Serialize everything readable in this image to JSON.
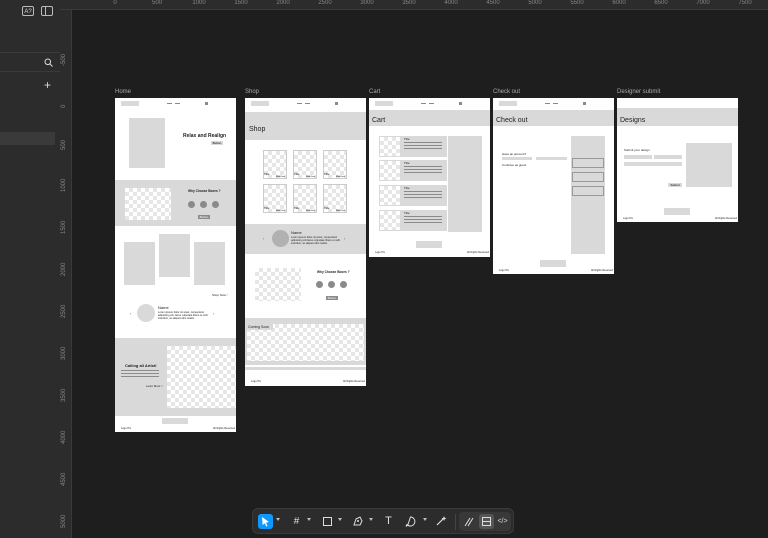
{
  "canvas": {
    "ruler_top": [
      "0",
      "500",
      "1000",
      "1500",
      "2000",
      "2500",
      "3000",
      "3500",
      "4000",
      "4500",
      "5000",
      "5500",
      "6000",
      "6500",
      "7000",
      "7500"
    ],
    "ruler_left": [
      "-500",
      "0",
      "500",
      "1000",
      "1500",
      "2000",
      "2500",
      "3000",
      "3500",
      "4000",
      "4500",
      "5000"
    ]
  },
  "sidebar": {
    "ai_icon": "A?"
  },
  "frames": {
    "home": {
      "label": "Home",
      "hero_title": "Relax and Realign",
      "hero_button": "Button",
      "why_title": "Why Choose Boxes ?",
      "why_button": "Button",
      "shop_now": "Shop Now !",
      "testimonial_name": "Name",
      "testimonial_text": "Lorem ipsum dolor sit amet, consectetur adipiscing elit, lacus vulputate libero et velit interdum, ac aliquet odio mattis.",
      "artist_title": "Calling all Artist!",
      "artist_link": "Learn More >",
      "footer_logo": "Logo Hm",
      "footer_copy": "All Rights Reserved"
    },
    "shop": {
      "label": "Shop",
      "page_title": "Shop",
      "product_title": "Title",
      "product_price": "$Add Item",
      "testimonial_name": "Name",
      "testimonial_text": "Lorem ipsum dolor sit amet, consectetur adipiscing elit lacus vulputate libero et velit interdum, ac aliquet odio mattis.",
      "why_title": "Why Choose Boxes ?",
      "why_button": "Button",
      "coming_soon": "Coming Soon",
      "footer_logo": "Logo Hm",
      "footer_copy": "All Rights Reserved"
    },
    "cart": {
      "label": "Cart",
      "page_title": "Cart",
      "item_title": "Title",
      "footer_logo": "Logo Hm",
      "footer_copy": "All Rights Reserved"
    },
    "checkout": {
      "label": "Check out",
      "page_title": "Check out",
      "account_q": "Have an account?",
      "guest": "Continue as guest",
      "footer_logo": "Logo Hm",
      "footer_copy": "All Rights Reserved"
    },
    "designs": {
      "label": "Designer submit",
      "page_title": "Designs",
      "submit_label": "Submit your design",
      "submit_button": "Submit",
      "footer_logo": "Logo Hm",
      "footer_copy": "All Rights Reserved"
    }
  },
  "toolbar": {
    "move_tool": "move-tool",
    "frame_tool": "frame-tool",
    "shape_tool": "rectangle-tool",
    "pen_tool": "pen-tool",
    "text_tool": "T",
    "comment_tool": "comment-tool",
    "actions_tool": "actions-tool",
    "dev_mode": "</>"
  }
}
